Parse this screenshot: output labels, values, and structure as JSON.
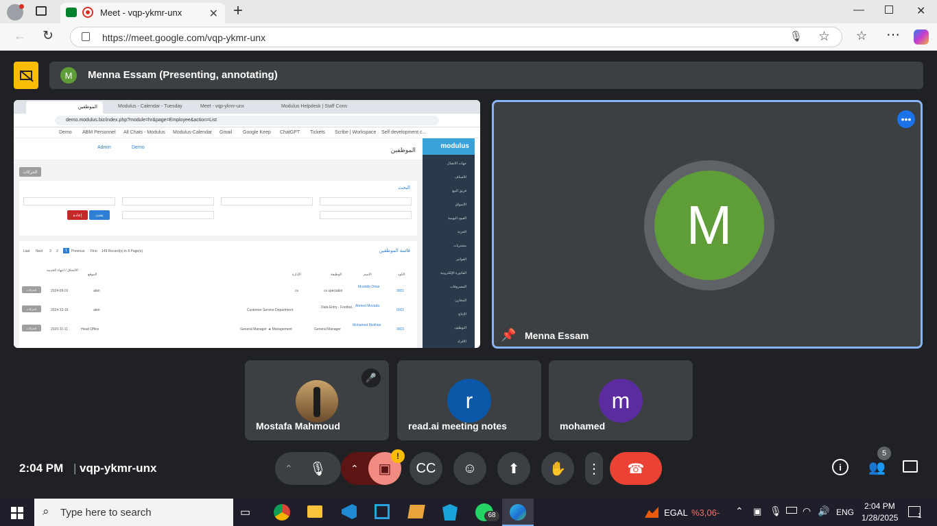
{
  "browser": {
    "tab_title": "Meet - vqp-ykmr-unx",
    "url": "https://meet.google.com/vqp-ykmr-unx",
    "new_tab": "+"
  },
  "meet": {
    "presenter_initial": "M",
    "presenting_label": "Menna Essam (Presenting, annotating)",
    "self_initial": "M",
    "self_name": "Menna Essam",
    "participants": [
      {
        "initial": "",
        "name": "Mostafa Mahmoud",
        "color": "#7b5b3a"
      },
      {
        "initial": "r",
        "name": "read.ai meeting notes",
        "color": "#0b57a8"
      },
      {
        "initial": "m",
        "name": "mohamed",
        "color": "#5b2ca0"
      }
    ],
    "time": "2:04 PM",
    "meeting_code": "vqp-ykmr-unx",
    "people_count": "5",
    "colors": {
      "green": "#5f9d38",
      "end_call": "#ea4335",
      "accent": "#8ab4f8",
      "warning": "#fbbc04"
    }
  },
  "shared": {
    "tabs": [
      "الموظفين",
      "Modulus - Calendar - Tuesday",
      "Meet - vqp-ykmr-unx",
      "Modulus Helpdesk | Staff Conn"
    ],
    "url": "demo.modulus.biz/index.php?module=hr&page=Employee&action=List",
    "bookmarks": [
      "Demo",
      "ABM Personnel",
      "All Chats - Modulus",
      "Modulus-Calendar",
      "Gmail",
      "Google Keep",
      "ChatGPT",
      "Tickets",
      "Scribe | Workspace",
      "Self development c..."
    ],
    "logo": "modulus",
    "page_title": "الموظفين",
    "admin": "Admin",
    "demo": "Demo",
    "search_title": "البحث",
    "btn_search": "بحث",
    "btn_reset": "إعادة",
    "list_title": "قائمة الموظفين",
    "pagination": [
      "Last",
      "Next",
      "3",
      "2",
      "1",
      "Previous",
      "First"
    ],
    "records": "149 Record(s) in 8 Page(s)",
    "headers": [
      "الكود",
      "الاسم",
      "الوظيفة",
      "الإدارة",
      "الموقع",
      "الالتحاق / انتهاء الخدمة"
    ],
    "rows": [
      {
        "code": "0001",
        "name": "Mustafa Omar",
        "job": "cs specialist",
        "dept": "cs",
        "loc": "abm",
        "date": "2024-09-01"
      },
      {
        "code": "0002",
        "name": "Ahmed Mostafa",
        "job": "Data Entry - Footbal...",
        "dept": "Customer Service Department",
        "loc": "abm",
        "date": "2024-12-16"
      },
      {
        "code": "0003",
        "name": "Mohamed Mokhtar",
        "job": "General Manager",
        "dept": "General Manager  ◄  Management",
        "loc": "Head Office",
        "date": "2020-11-11"
      }
    ],
    "actions": "الحركات",
    "menu": [
      "جهات الاتصال",
      "الأصناف",
      "فريق البيع",
      "الأسواق",
      "القيود اليومية",
      "الخزنة",
      "مشتريات",
      "الفواتير",
      "الفاتورة الإلكترونية",
      "المصروفات",
      "المخازن",
      "الإنتاج",
      "التوظيف",
      "الأفراد"
    ]
  },
  "taskbar": {
    "search_placeholder": "Type here to search",
    "stock": "EGAL",
    "stock_change": "%3,06-",
    "lang": "ENG",
    "time": "2:04 PM",
    "date": "1/28/2025",
    "whatsapp_badge": "68",
    "notif_count": "1"
  }
}
